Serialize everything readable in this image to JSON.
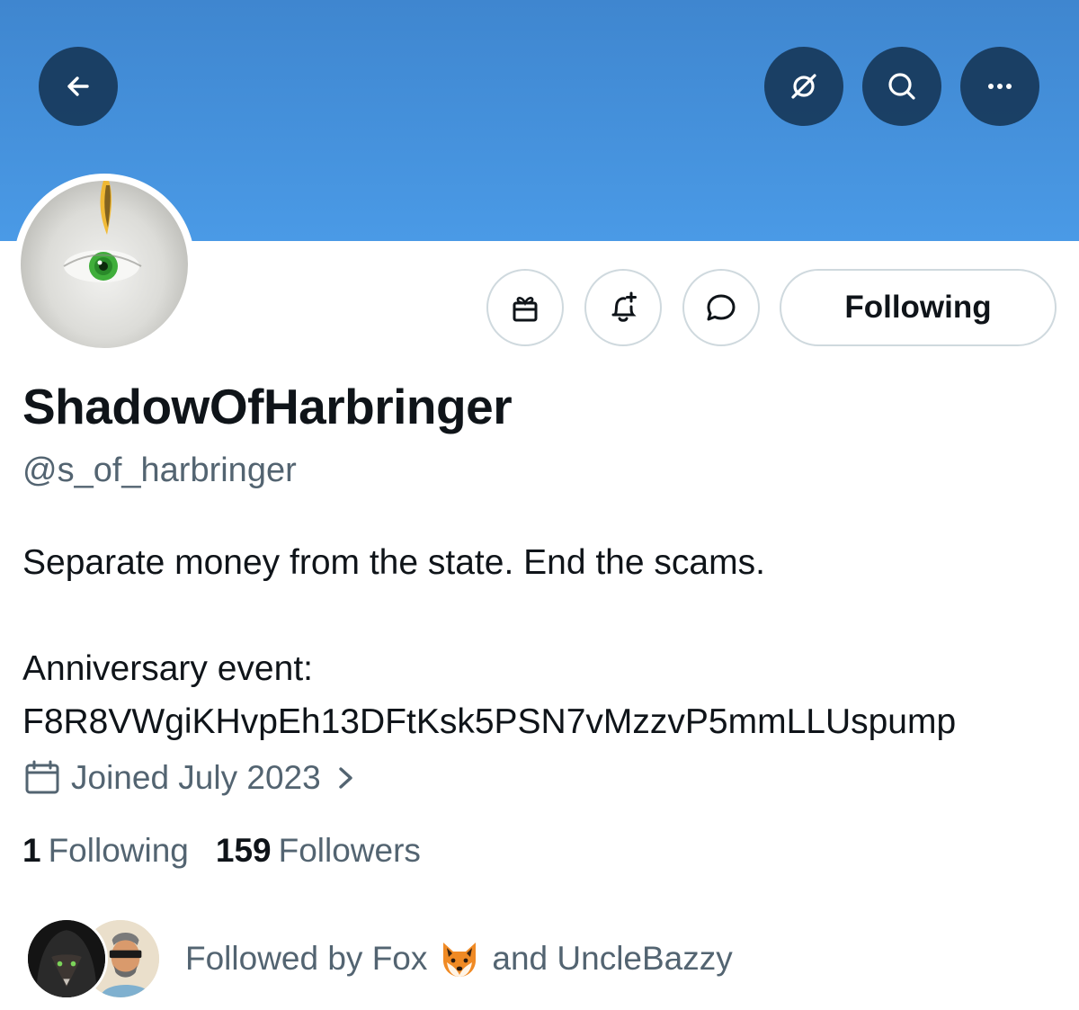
{
  "header": {
    "back_icon": "arrow-left-icon",
    "translate_icon": "no-translate-icon",
    "search_icon": "search-icon",
    "more_icon": "more-horizontal-icon",
    "banner_color": "#4a9ae6"
  },
  "actions": {
    "gift_icon": "gift-icon",
    "notify_icon": "bell-plus-icon",
    "message_icon": "message-bubble-icon",
    "following_label": "Following"
  },
  "profile": {
    "display_name": "ShadowOfHarbringer",
    "handle": "@s_of_harbringer",
    "bio_line1": "Separate money from the state. End the scams.",
    "bio_line2": "Anniversary event:",
    "bio_line3": "F8R8VWgiKHvpEh13DFtKsk5PSN7vMzzvP5mmLLUspump",
    "joined": "Joined July 2023",
    "following_count": "1",
    "following_label": "Following",
    "followers_count": "159",
    "followers_label": "Followers"
  },
  "followed_by": {
    "prefix": "Followed by Fox",
    "suffix": "and UncleBazzy"
  }
}
